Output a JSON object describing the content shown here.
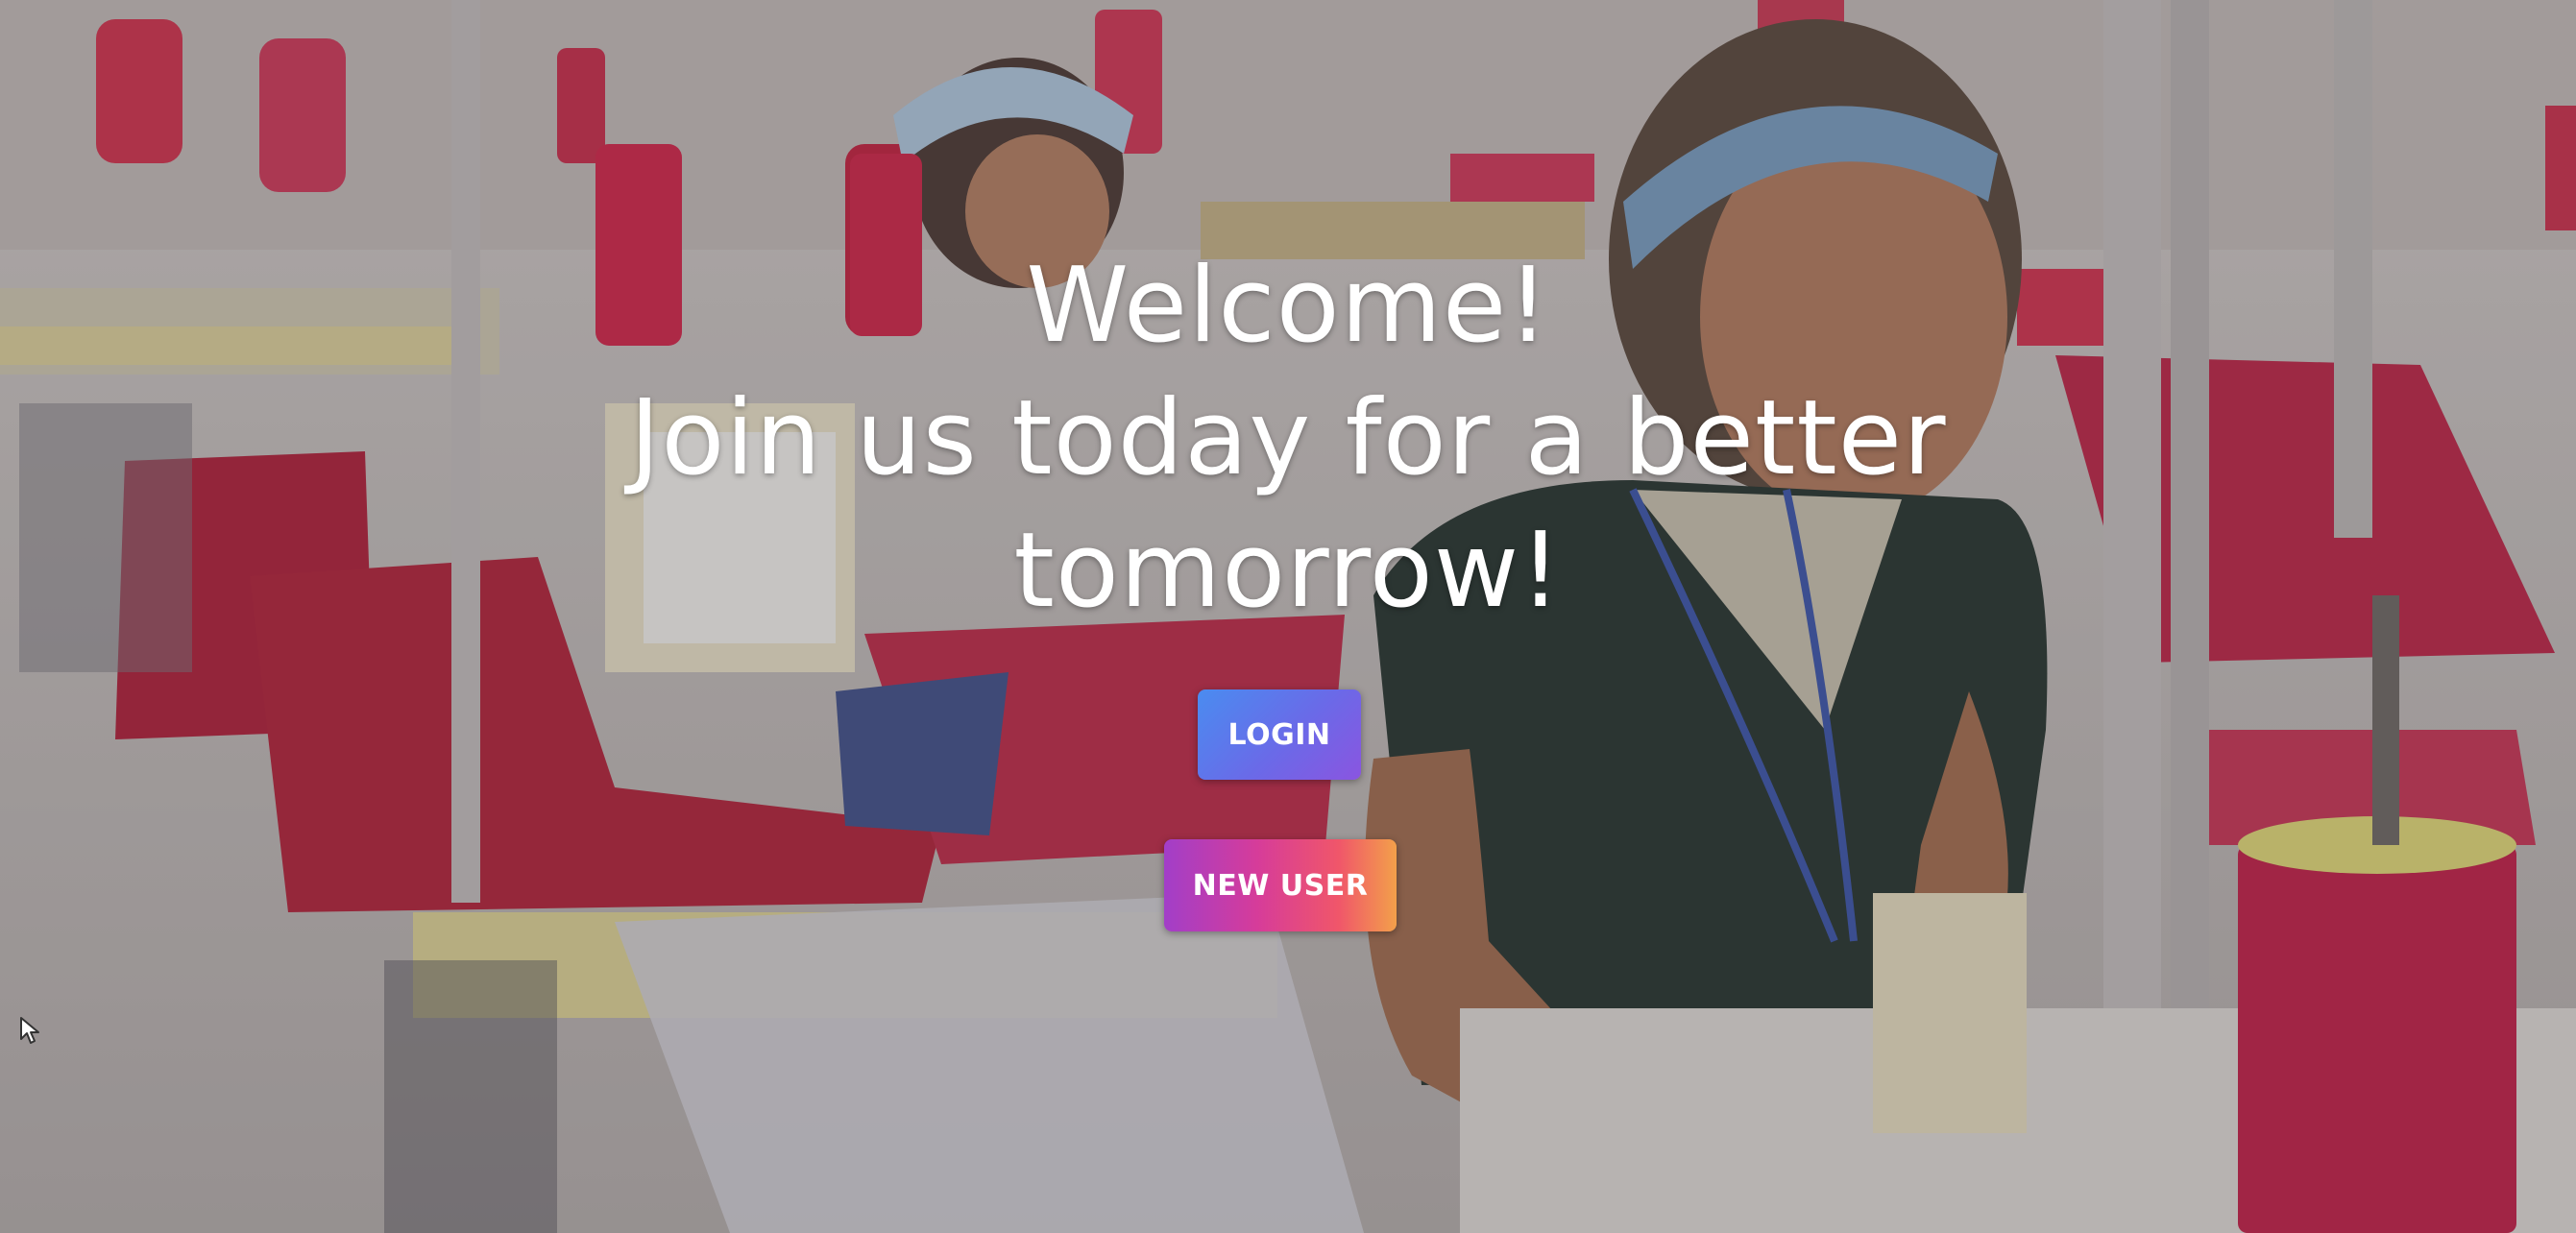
{
  "hero": {
    "title_line1": "Welcome!",
    "title_line2": "Join us today for a better tomorrow!"
  },
  "buttons": {
    "login_label": "LOGIN",
    "new_user_label": "NEW USER"
  },
  "colors": {
    "login_gradient_start": "#4a8cf0",
    "login_gradient_end": "#8a55e0",
    "new_user_gradient_start": "#a23ec8",
    "new_user_gradient_end": "#f3a04a",
    "text": "#ffffff"
  }
}
